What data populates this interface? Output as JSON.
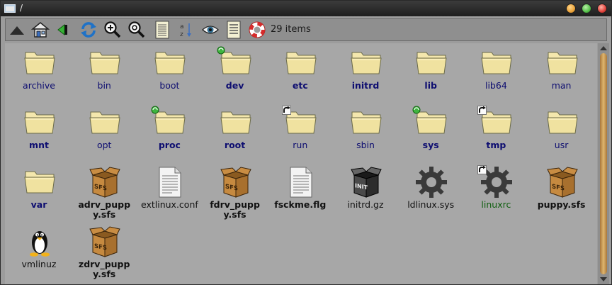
{
  "window": {
    "title": "/"
  },
  "toolbar": {
    "item_count": "29 items",
    "buttons": [
      {
        "name": "up-arrow-icon"
      },
      {
        "name": "home-icon"
      },
      {
        "name": "back-icon"
      },
      {
        "name": "refresh-icon"
      },
      {
        "name": "zoom-in-icon"
      },
      {
        "name": "zoom-fit-icon"
      },
      {
        "name": "details-view-icon"
      },
      {
        "name": "sort-icon"
      },
      {
        "name": "show-hidden-icon"
      },
      {
        "name": "list-view-icon"
      },
      {
        "name": "help-icon"
      }
    ]
  },
  "colors": {
    "folder": "#f0e2a0",
    "label_blue": "#0d0d70",
    "label_green": "#0f5e0f",
    "close": "#e0413a",
    "maximize": "#55c04a",
    "minimize": "#eba33a"
  },
  "files": [
    {
      "label": "archive",
      "icon": "folder-icon",
      "style": "normal"
    },
    {
      "label": "bin",
      "icon": "folder-icon",
      "style": "normal"
    },
    {
      "label": "boot",
      "icon": "folder-icon",
      "style": "normal"
    },
    {
      "label": "dev",
      "icon": "folder-icon",
      "style": "bold",
      "badge": "green"
    },
    {
      "label": "etc",
      "icon": "folder-icon",
      "style": "bold"
    },
    {
      "label": "initrd",
      "icon": "folder-icon",
      "style": "bold"
    },
    {
      "label": "lib",
      "icon": "folder-icon",
      "style": "bold"
    },
    {
      "label": "lib64",
      "icon": "folder-icon",
      "style": "normal"
    },
    {
      "label": "man",
      "icon": "folder-icon",
      "style": "normal"
    },
    {
      "label": "mnt",
      "icon": "folder-icon",
      "style": "bold"
    },
    {
      "label": "opt",
      "icon": "folder-icon",
      "style": "normal"
    },
    {
      "label": "proc",
      "icon": "folder-icon",
      "style": "bold",
      "badge": "green"
    },
    {
      "label": "root",
      "icon": "folder-icon",
      "style": "bold"
    },
    {
      "label": "run",
      "icon": "folder-icon",
      "style": "normal",
      "badge": "link"
    },
    {
      "label": "sbin",
      "icon": "folder-icon",
      "style": "normal"
    },
    {
      "label": "sys",
      "icon": "folder-icon",
      "style": "bold",
      "badge": "green"
    },
    {
      "label": "tmp",
      "icon": "folder-icon",
      "style": "bold",
      "badge": "link"
    },
    {
      "label": "usr",
      "icon": "folder-icon",
      "style": "normal"
    },
    {
      "label": "var",
      "icon": "folder-icon",
      "style": "bold"
    },
    {
      "label": "adrv_puppy.sfs",
      "icon": "sfs-box-icon",
      "style": "blackbold"
    },
    {
      "label": "extlinux.conf",
      "icon": "text-file-icon",
      "style": "black"
    },
    {
      "label": "fdrv_puppy.sfs",
      "icon": "sfs-box-icon",
      "style": "blackbold"
    },
    {
      "label": "fsckme.flg",
      "icon": "text-file-icon",
      "style": "blackbold"
    },
    {
      "label": "initrd.gz",
      "icon": "init-box-icon",
      "style": "black"
    },
    {
      "label": "ldlinux.sys",
      "icon": "gear-icon",
      "style": "black"
    },
    {
      "label": "linuxrc",
      "icon": "gear-icon",
      "style": "green",
      "badge": "link"
    },
    {
      "label": "puppy.sfs",
      "icon": "sfs-box-icon",
      "style": "blackbold"
    },
    {
      "label": "vmlinuz",
      "icon": "penguin-icon",
      "style": "black"
    },
    {
      "label": "zdrv_puppy.sfs",
      "icon": "sfs-box-icon",
      "style": "blackbold"
    }
  ]
}
